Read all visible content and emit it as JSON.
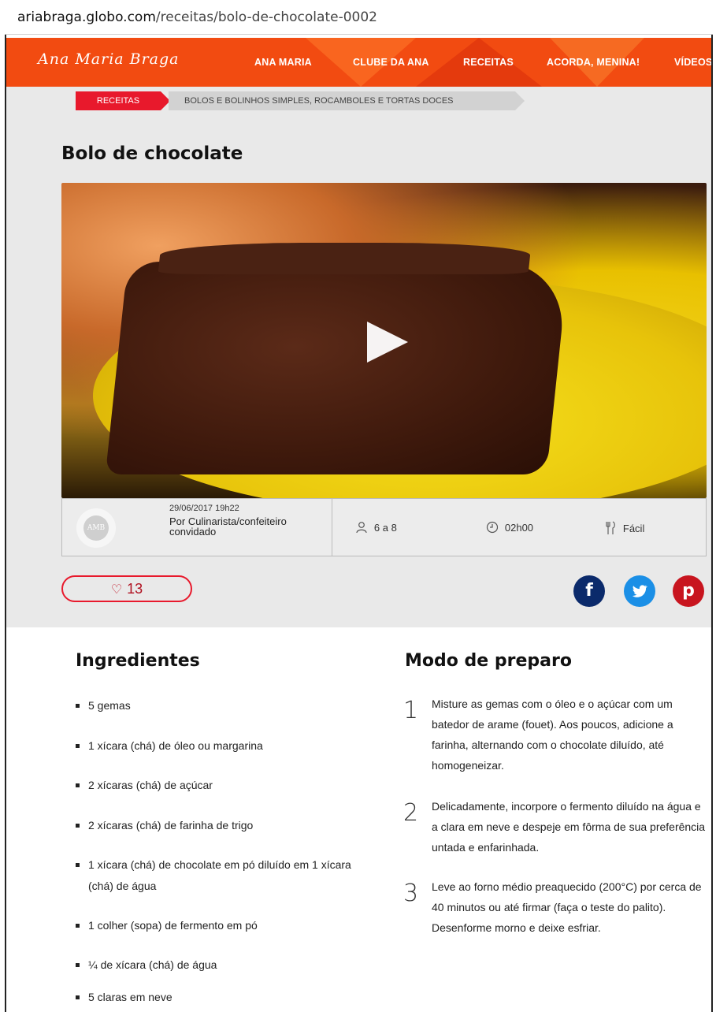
{
  "browser": {
    "url_prefix": "ariabraga.globo.com",
    "url_path": "/receitas/bolo-de-chocolate-0002"
  },
  "nav": {
    "logo": "Ana Maria Braga",
    "items": [
      "ANA MARIA",
      "CLUBE DA ANA",
      "RECEITAS",
      "ACORDA, MENINA!",
      "VÍDEOS"
    ]
  },
  "breadcrumb": {
    "category": "RECEITAS",
    "subcategory": "BOLOS E BOLINHOS SIMPLES, ROCAMBOLES E TORTAS DOCES"
  },
  "recipe": {
    "title": "Bolo de chocolate",
    "avatar_initials": "AMB",
    "date": "29/06/2017 19h22",
    "author": "Por Culinarista/confeiteiro convidado",
    "servings": "6 a 8",
    "time": "02h00",
    "difficulty": "Fácil",
    "likes": "13"
  },
  "icons": {
    "user": "user-icon",
    "clock": "clock-icon",
    "utensils": "utensils-icon",
    "heart": "heart-icon",
    "play": "play-icon"
  },
  "social": {
    "facebook": "f",
    "twitter": "t",
    "pinterest": "p"
  },
  "colors": {
    "brand_orange": "#f24b11",
    "accent_red": "#e8192c",
    "facebook": "#0b2a6b",
    "twitter": "#1b8fe6",
    "pinterest": "#c8151f"
  },
  "ingredients_title": "Ingredientes",
  "ingredients": [
    "5 gemas",
    "1 xícara (chá) de óleo ou margarina",
    "2 xícaras (chá) de açúcar",
    "2 xícaras (chá) de farinha de trigo",
    "1 xícara (chá) de chocolate em pó diluído em 1 xícara (chá) de água",
    "1 colher (sopa) de fermento em pó",
    "¼ de xícara (chá) de água",
    "5 claras em neve"
  ],
  "preparation_title": "Modo de preparo",
  "steps": [
    {
      "num": "1",
      "text": "Misture as gemas com o óleo e o açúcar com um batedor de arame (fouet). Aos poucos, adicione a farinha, alternando com o chocolate diluído, até homogeneizar."
    },
    {
      "num": "2",
      "text": "Delicadamente, incorpore o fermento diluído na água e a clara em neve e despeje em fôrma de sua preferência untada e enfarinhada."
    },
    {
      "num": "3",
      "text": "Leve ao forno médio preaquecido (200°C) por cerca de 40 minutos ou até firmar (faça o teste do palito). Desenforme morno e deixe esfriar."
    }
  ]
}
